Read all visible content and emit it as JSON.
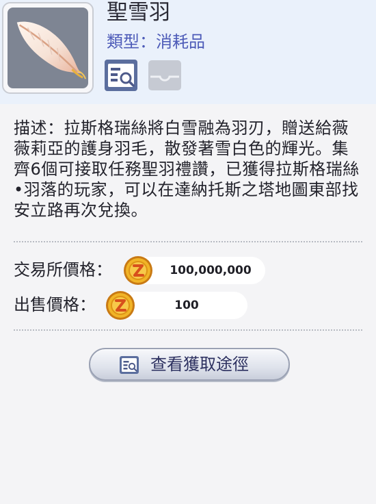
{
  "item": {
    "name": "聖雪羽",
    "type": "類型：消耗品",
    "icon": "feather-icon",
    "badges": [
      "view-details-icon",
      "card-slot-icon"
    ]
  },
  "description": "描述：拉斯格瑞絲將白雪融為羽刃，贈送給薇薇莉亞的護身羽毛，散發著雪白色的輝光。集齊6個可接取任務聖羽禮讚，已獲得拉斯格瑞絲•羽落的玩家，可以在達納托斯之塔地圖東部找安立路再次兌換。",
  "prices": {
    "exchange_label": "交易所價格：",
    "exchange_value": "100,000,000",
    "sell_label": "出售價格：",
    "sell_value": "100",
    "currency_icon": "zeny-coin-icon"
  },
  "actions": {
    "acquire_label": "查看獲取途徑"
  },
  "colors": {
    "header_bg": "#eaf1fb",
    "type_text": "#4d5bb8",
    "coin": "#f1b427"
  }
}
